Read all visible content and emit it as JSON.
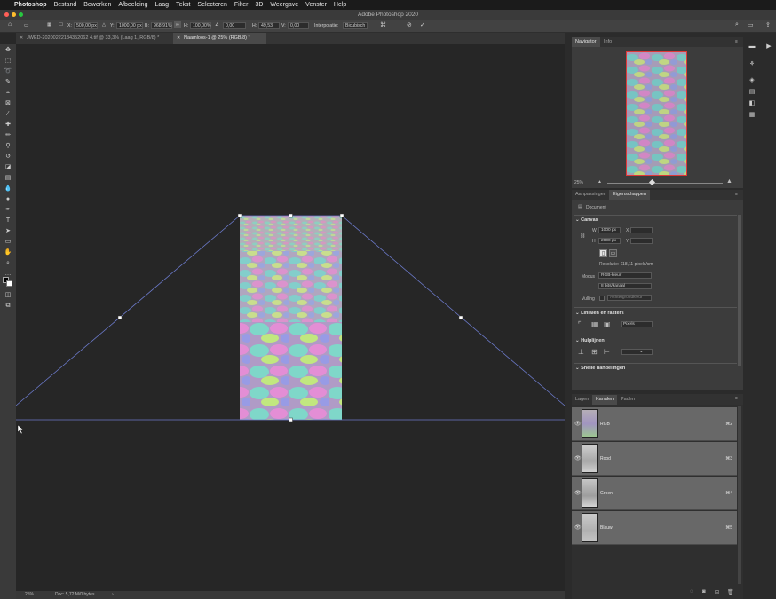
{
  "menubar": {
    "apple": "",
    "app": "Photoshop",
    "items": [
      "Bestand",
      "Bewerken",
      "Afbeelding",
      "Laag",
      "Tekst",
      "Selecteren",
      "Filter",
      "3D",
      "Weergave",
      "Venster",
      "Help"
    ]
  },
  "window_title": "Adobe Photoshop 2020",
  "options": {
    "x_label": "X:",
    "x_value": "500,00 px",
    "y_label": "Y:",
    "y_value": "1000,00 px",
    "w_label": "B:",
    "w_value": "968,91%",
    "h_label": "H:",
    "h_value": "100,00%",
    "angle_value": "0,00",
    "hskew_label": "H:",
    "hskew_value": "49,53",
    "vskew_label": "V:",
    "vskew_value": "0,00",
    "interp_label": "Interpolatie:",
    "interp_value": "Bicubisch"
  },
  "doc_tabs": [
    {
      "label": "JWED-20200222134352062 4.tif @ 33,3% (Laag 1, RGB/8) *",
      "active": false
    },
    {
      "label": "Naamloos-1 @ 25% (RGB/8) *",
      "active": true
    }
  ],
  "status": {
    "zoom": "25%",
    "doc": "Doc: 5,72 M/0 bytes"
  },
  "navigator": {
    "tabs": [
      "Navigator",
      "Info"
    ],
    "zoom": "25%"
  },
  "properties": {
    "tabs": [
      "Aanpassingen",
      "Eigenschappen"
    ],
    "kind": "Document",
    "canvas_title": "Canvas",
    "w_label": "W",
    "w_value": "1000 px",
    "x_label": "X",
    "h_label": "H",
    "h_value": "2000 px",
    "y_label": "Y",
    "resolution": "Resolutie: 118,11 pixels/cm",
    "mode_label": "Modus",
    "mode_value": "RGB-kleur",
    "bits_value": "8 bits/kanaal",
    "fill_label": "Vulling",
    "fill_value": "Achtergrondkleur",
    "rulers_title": "Linialen en rasters",
    "units_value": "Pixels",
    "guides_title": "Hulplijnen",
    "quick_title": "Snelle handelingen"
  },
  "channels": {
    "tabs": [
      "Lagen",
      "Kanalen",
      "Paden"
    ],
    "rows": [
      {
        "name": "RGB",
        "key": "⌘2"
      },
      {
        "name": "Rood",
        "key": "⌘3"
      },
      {
        "name": "Groen",
        "key": "⌘4"
      },
      {
        "name": "Blauw",
        "key": "⌘5"
      }
    ]
  }
}
